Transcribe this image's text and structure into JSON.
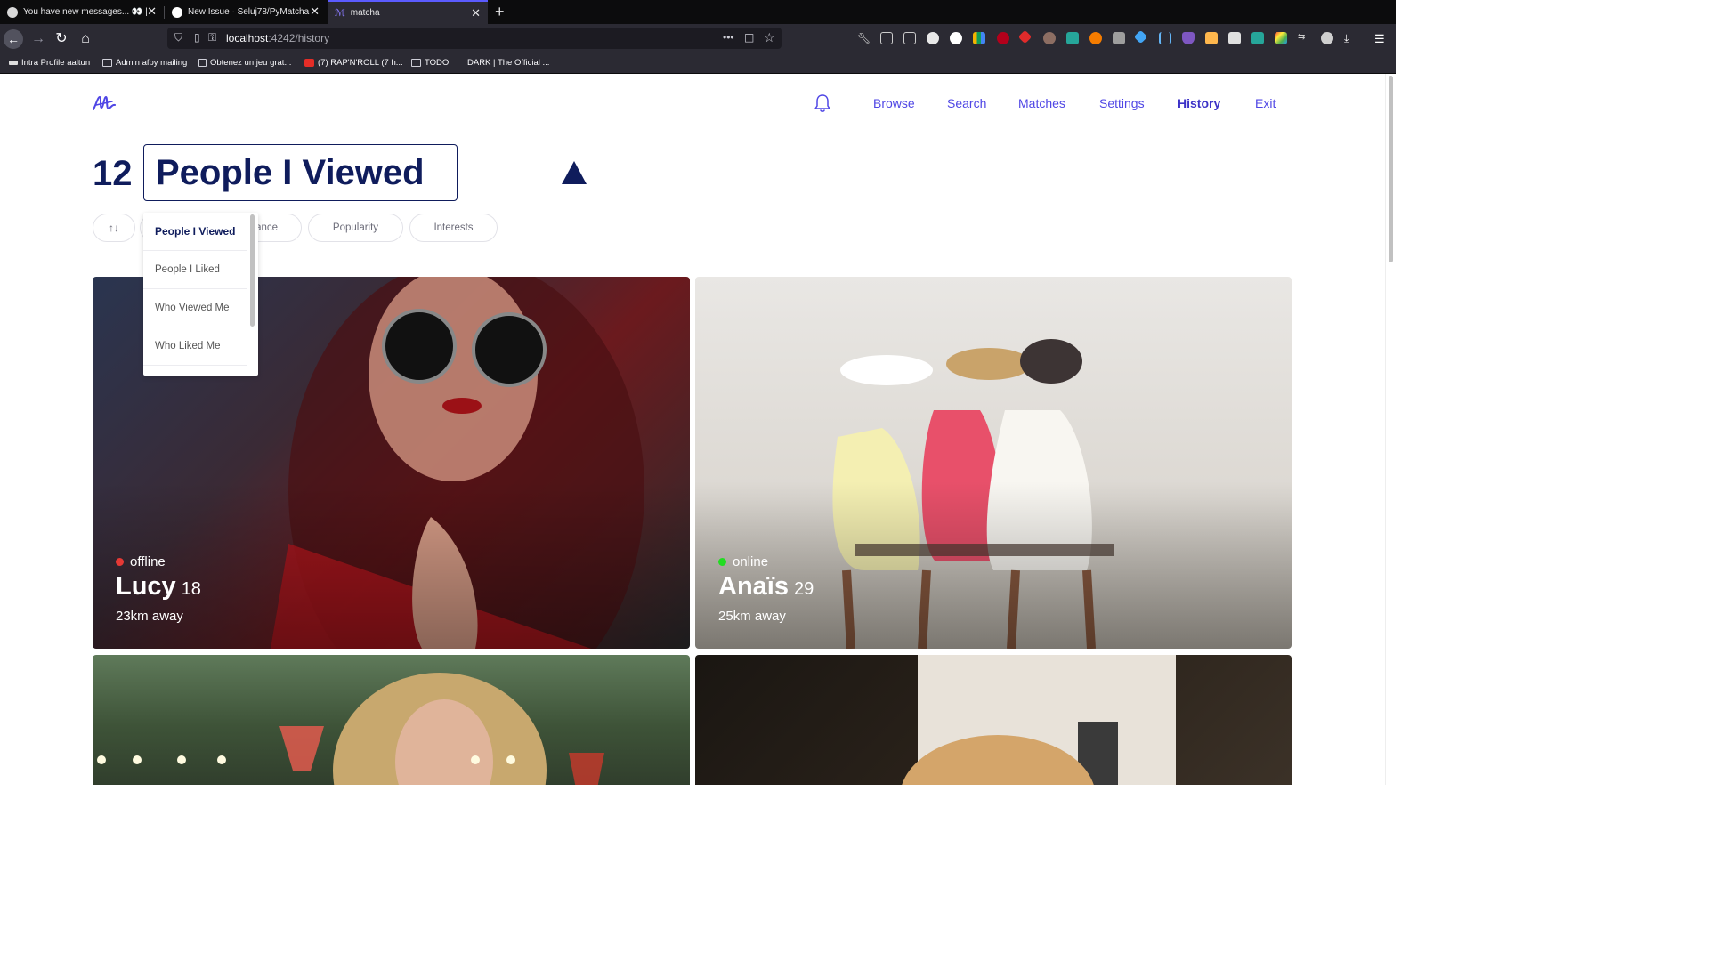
{
  "browser": {
    "tabs": [
      {
        "title": "You have new messages... 👀 |",
        "active": false
      },
      {
        "title": "New Issue · Seluj78/PyMatcha",
        "active": false
      },
      {
        "title": "matcha",
        "active": true
      }
    ],
    "url_host": "localhost",
    "url_path": ":4242/history",
    "bookmarks": [
      "Intra Profile aaltun",
      "Admin afpy mailing",
      "Obtenez un jeu grat...",
      "(7) RAP'N'ROLL (7 h...",
      "TODO",
      "DARK | The Official ..."
    ],
    "icons": {
      "back": "back-arrow-icon",
      "forward": "forward-arrow-icon",
      "reload": "reload-icon",
      "home": "home-icon",
      "menu": "hamburger-menu-icon"
    }
  },
  "site": {
    "nav": {
      "links": [
        "Browse",
        "Search",
        "Matches",
        "Settings",
        "History",
        "Exit"
      ],
      "active": "History"
    },
    "accent_color": "#4f46e5",
    "heading_color": "#0f1c5c"
  },
  "history": {
    "count": "12",
    "selected_view": "People I Viewed",
    "views": [
      "People I Viewed",
      "People I Liked",
      "Who Viewed Me",
      "Who Liked Me"
    ],
    "sort_icon": "↑↓",
    "filters": [
      "Distance",
      "Popularity",
      "Interests"
    ],
    "filter_distance_visible": "ance"
  },
  "profiles": [
    {
      "status": "offline",
      "status_color": "#e53935",
      "name": "Lucy",
      "age": "18",
      "distance": "23km away"
    },
    {
      "status": "online",
      "status_color": "#22dd22",
      "name": "Anaïs",
      "age": "29",
      "distance": "25km away"
    },
    {
      "status": "",
      "name": "",
      "age": "",
      "distance": ""
    },
    {
      "status": "",
      "name": "",
      "age": "",
      "distance": ""
    }
  ]
}
